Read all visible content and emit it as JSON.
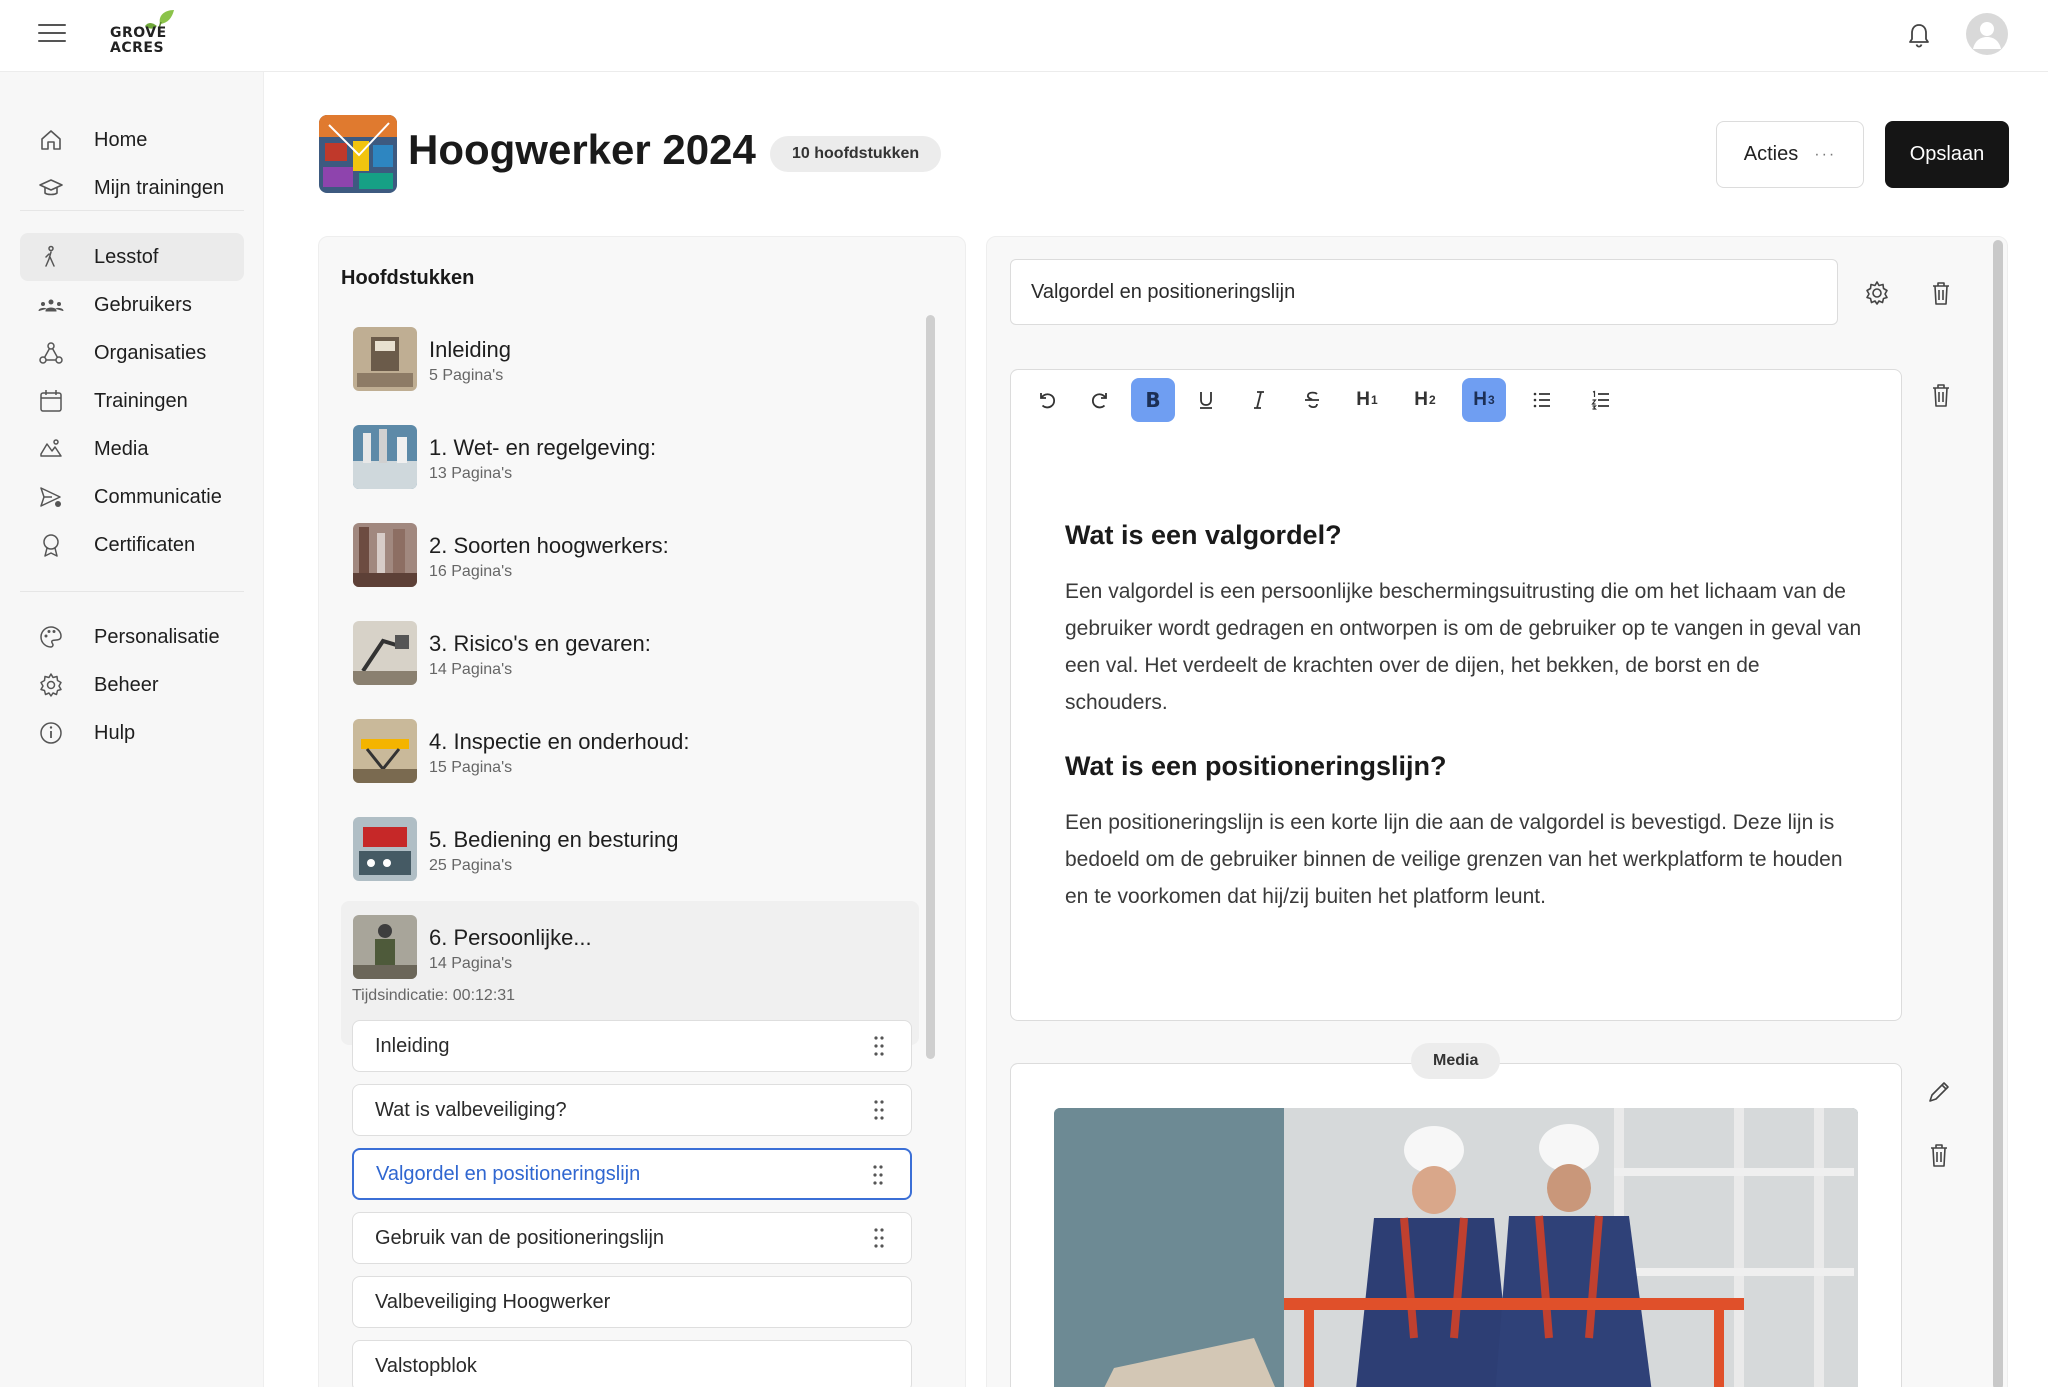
{
  "app": {
    "logo_text": "GROVE ACRES",
    "brand_color": "#8bc34a"
  },
  "sidebar": {
    "items": [
      {
        "label": "Home",
        "icon": "home-icon"
      },
      {
        "label": "Mijn trainingen",
        "icon": "graduation-cap-icon"
      },
      {
        "label": "Lesstof",
        "icon": "person-walking-icon",
        "active": true
      },
      {
        "label": "Gebruikers",
        "icon": "users-icon"
      },
      {
        "label": "Organisaties",
        "icon": "network-icon"
      },
      {
        "label": "Trainingen",
        "icon": "calendar-icon"
      },
      {
        "label": "Media",
        "icon": "media-icon"
      },
      {
        "label": "Communicatie",
        "icon": "send-icon"
      },
      {
        "label": "Certificaten",
        "icon": "award-icon"
      },
      {
        "label": "Personalisatie",
        "icon": "palette-icon"
      },
      {
        "label": "Beheer",
        "icon": "gear-icon"
      },
      {
        "label": "Hulp",
        "icon": "info-icon"
      }
    ]
  },
  "header": {
    "title": "Hoogwerker 2024",
    "chapters_badge": "10 hoofdstukken",
    "actions_label": "Acties",
    "save_label": "Opslaan"
  },
  "chapters": {
    "heading": "Hoofdstukken",
    "items": [
      {
        "title": "Inleiding",
        "pages": "5 Pagina's"
      },
      {
        "title": "1. Wet- en regelgeving:",
        "pages": "13 Pagina's"
      },
      {
        "title": "2. Soorten hoogwerkers:",
        "pages": "16 Pagina's"
      },
      {
        "title": "3. Risico's en gevaren:",
        "pages": "14 Pagina's"
      },
      {
        "title": "4. Inspectie en onderhoud:",
        "pages": "15 Pagina's"
      },
      {
        "title": "5. Bediening en besturing",
        "pages": "25 Pagina's"
      },
      {
        "title": "6. Persoonlijke...",
        "pages": "14 Pagina's",
        "expanded": true
      }
    ],
    "time_indication": "Tijdsindicatie: 00:12:31",
    "lessons": [
      {
        "label": "Inleiding"
      },
      {
        "label": "Wat is valbeveiliging?"
      },
      {
        "label": "Valgordel en positioneringslijn",
        "active": true
      },
      {
        "label": "Gebruik van de positioneringslijn"
      },
      {
        "label": "Valbeveiliging Hoogwerker"
      },
      {
        "label": "Valstopblok"
      }
    ]
  },
  "editor": {
    "lesson_title_value": "Valgordel en positioneringslijn",
    "toolbar": {
      "h1": "H",
      "h1_sub": "1",
      "h2": "H",
      "h2_sub": "2",
      "h3": "H",
      "h3_sub": "3",
      "bold": "B"
    },
    "content": {
      "heading1": "Wat is een valgordel?",
      "paragraph1": "Een valgordel is een persoonlijke beschermingsuitrusting die om het lichaam van de gebruiker wordt gedragen en ontworpen is om de gebruiker op te vangen in geval van een val. Het verdeelt de krachten over de dijen, het bekken, de borst en de schouders.",
      "heading2": "Wat is een positioneringslijn?",
      "paragraph2": "Een positioneringslijn is een korte lijn die aan de valgordel is bevestigd. Deze lijn is bedoeld om de gebruiker binnen de veilige grenzen van het werkplatform te houden en te voorkomen dat hij/zij buiten het platform leunt."
    },
    "media_badge": "Media",
    "active_format_color": "#6f9ef2"
  }
}
